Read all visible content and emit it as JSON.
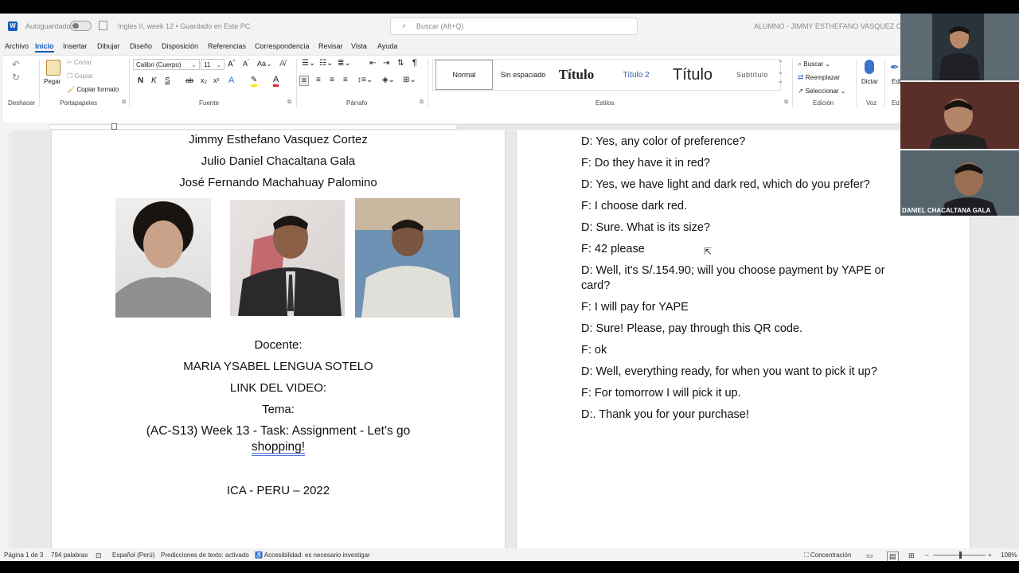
{
  "titlebar": {
    "autosave": "Autoguardado",
    "document_name": "Ingles II, week 12 • Guardado en Este PC",
    "search_placeholder": "Buscar (Alt+Q)",
    "user": "ALUMNO - JIMMY ESTHEFANO VASQUEZ CORTEZ"
  },
  "tabs": [
    "Archivo",
    "Inicio",
    "Insertar",
    "Dibujar",
    "Diseño",
    "Disposición",
    "Referencias",
    "Correspondencia",
    "Revisar",
    "Vista",
    "Ayuda"
  ],
  "active_tab": "Inicio",
  "ribbon": {
    "undo_group": "Deshacer",
    "clipboard": {
      "paste": "Pegar",
      "cut": "Cortar",
      "copy": "Copiar",
      "format_painter": "Copiar formato",
      "label": "Portapapeles"
    },
    "font": {
      "name": "Calibri (Cuerpo)",
      "size": "11",
      "label": "Fuente"
    },
    "paragraph_label": "Párrafo",
    "styles": {
      "items": [
        "Normal",
        "Sin espaciado",
        "Título",
        "Título 2",
        "Título",
        "Subtítulo"
      ],
      "label": "Estilos"
    },
    "editing": {
      "find": "Buscar",
      "replace": "Reemplazar",
      "select": "Seleccionar",
      "label": "Edición"
    },
    "voice": {
      "dictate": "Dictar",
      "label": "Voz"
    },
    "editor_partial": "Edi",
    "editor_label_partial": "Ed"
  },
  "page1": {
    "names": [
      "Jimmy Esthefano Vasquez Cortez",
      "Julio Daniel Chacaltana Gala",
      "José Fernando Machahuay Palomino"
    ],
    "docente_label": "Docente:",
    "docente": "MARIA YSABEL LENGUA SOTELO",
    "link_label": "LINK DEL VIDEO:",
    "tema_label": "Tema:",
    "tema_line1": "(AC-S13) Week 13 - Task: Assignment - Let's go",
    "tema_line2": "shopping!",
    "footer": "ICA - PERU – 2022"
  },
  "page2": {
    "dialogue": [
      "D: Yes, any color of preference?",
      "F: Do they have it in red?",
      "D: Yes, we have light and dark red, which do you prefer?",
      "F: I choose dark red.",
      "D: Sure. What is its size?",
      "F: 42 please",
      "D: Well, it's S/.154.90; will you choose payment by YAPE or card?",
      "F: I will pay for YAPE",
      "D: Sure! Please, pay through this QR code.",
      "F: ok",
      "D: Well, everything ready, for when you want to pick it up?",
      "F: For tomorrow I will pick it up.",
      "D:. Thank you for your purchase!"
    ]
  },
  "statusbar": {
    "page": "Página 1 de 3",
    "words": "794 palabras",
    "language": "Español (Perú)",
    "predictions": "Predicciones de texto: activado",
    "accessibility": "Accesibilidad: es necesario investigar",
    "focus": "Concentración",
    "zoom": "108%"
  },
  "participants": {
    "tile3_name": "DANIEL CHACALTANA GALA"
  },
  "colors": {
    "accent": "#185abd",
    "spell_error": "#dd4444",
    "grammar": "#4a6fd8"
  }
}
